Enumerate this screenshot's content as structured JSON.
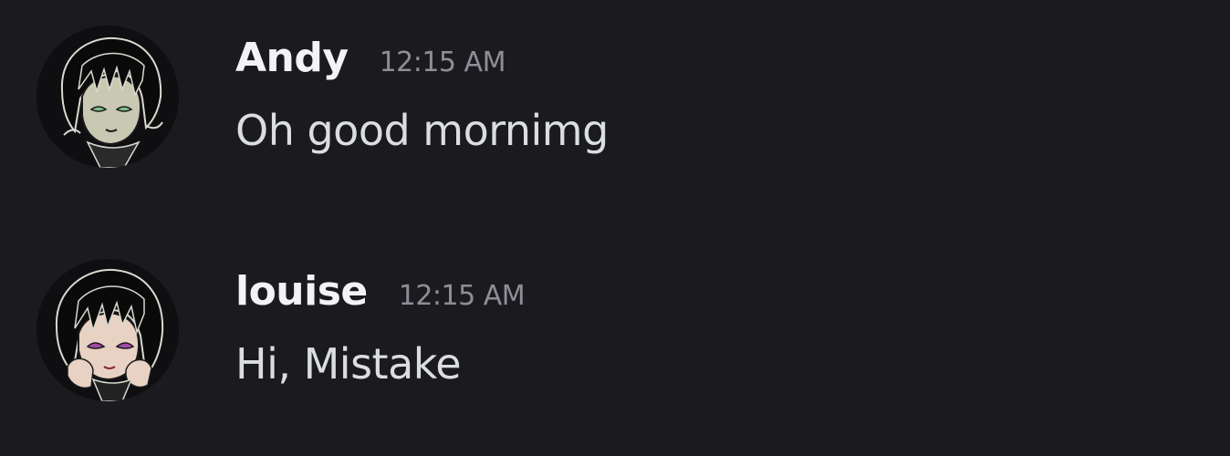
{
  "colors": {
    "background": "#1b1b1f",
    "username": "#f2f3f5",
    "timestamp": "#8d8f96",
    "message_text": "#dbdee1"
  },
  "messages": [
    {
      "author": "Andy",
      "timestamp": "12:15 AM",
      "text": "Oh good mornimg",
      "avatar_icon": "avatar-icon"
    },
    {
      "author": "louise",
      "timestamp": "12:15 AM",
      "text": "Hi, Mistake",
      "avatar_icon": "avatar-icon"
    }
  ]
}
